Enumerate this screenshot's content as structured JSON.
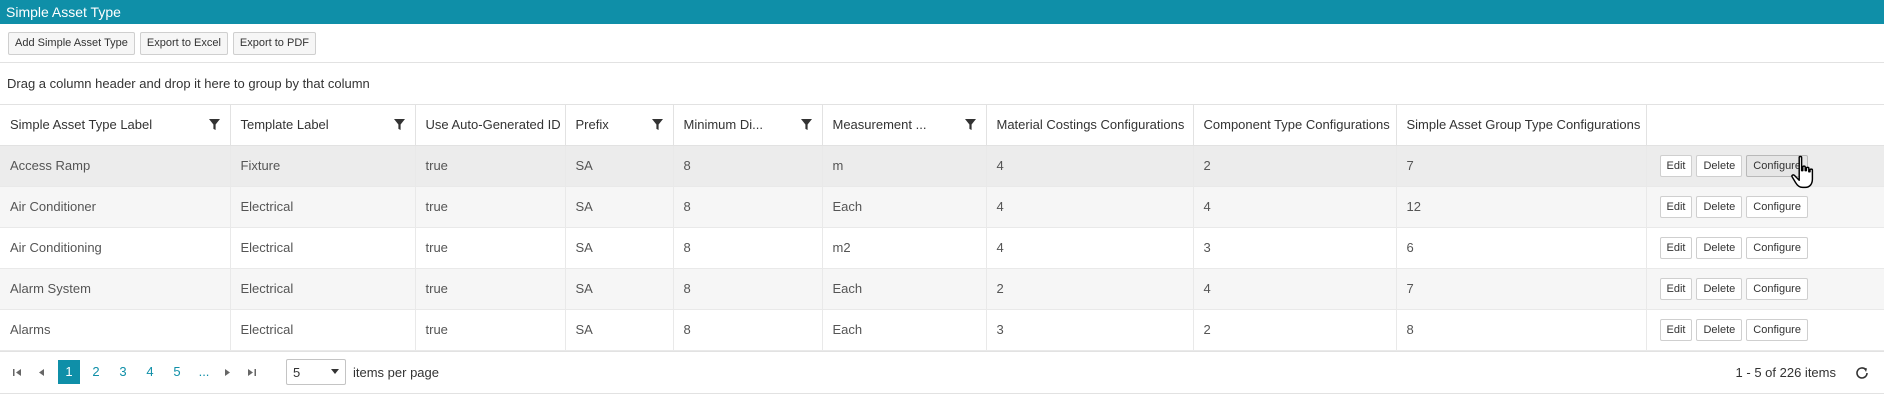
{
  "title": "Simple Asset Type",
  "toolbar": {
    "add_label": "Add Simple Asset Type",
    "excel_label": "Export to Excel",
    "pdf_label": "Export to PDF"
  },
  "group_hint": "Drag a column header and drop it here to group by that column",
  "columns": [
    {
      "label": "Simple Asset Type Label",
      "filter": true
    },
    {
      "label": "Template Label",
      "filter": true
    },
    {
      "label": "Use Auto-Generated ID",
      "filter": false
    },
    {
      "label": "Prefix",
      "filter": true
    },
    {
      "label": "Minimum Di...",
      "filter": true
    },
    {
      "label": "Measurement ...",
      "filter": true
    },
    {
      "label": "Material Costings Configurations",
      "filter": false
    },
    {
      "label": "Component Type Configurations",
      "filter": false
    },
    {
      "label": "Simple Asset Group Type Configurations",
      "filter": false
    },
    {
      "label": "",
      "filter": false
    }
  ],
  "rows": [
    {
      "label": "Access Ramp",
      "template": "Fixture",
      "auto_id": "true",
      "prefix": "SA",
      "min_digits": "8",
      "measurement": "m",
      "material": "4",
      "component": "2",
      "group": "7"
    },
    {
      "label": "Air Conditioner",
      "template": "Electrical",
      "auto_id": "true",
      "prefix": "SA",
      "min_digits": "8",
      "measurement": "Each",
      "material": "4",
      "component": "4",
      "group": "12"
    },
    {
      "label": "Air Conditioning",
      "template": "Electrical",
      "auto_id": "true",
      "prefix": "SA",
      "min_digits": "8",
      "measurement": "m2",
      "material": "4",
      "component": "3",
      "group": "6"
    },
    {
      "label": "Alarm System",
      "template": "Electrical",
      "auto_id": "true",
      "prefix": "SA",
      "min_digits": "8",
      "measurement": "Each",
      "material": "2",
      "component": "4",
      "group": "7"
    },
    {
      "label": "Alarms",
      "template": "Electrical",
      "auto_id": "true",
      "prefix": "SA",
      "min_digits": "8",
      "measurement": "Each",
      "material": "3",
      "component": "2",
      "group": "8"
    }
  ],
  "row_actions": {
    "edit": "Edit",
    "delete": "Delete",
    "configure": "Configure"
  },
  "pager": {
    "pages": [
      "1",
      "2",
      "3",
      "4",
      "5",
      "..."
    ],
    "current_page": "1",
    "page_size": "5",
    "items_per_page_label": "items per page",
    "info": "1 - 5 of 226 items"
  },
  "icons": {
    "filter": "filter-icon",
    "first": "first-page-icon",
    "prev": "prev-page-icon",
    "next": "next-page-icon",
    "last": "last-page-icon",
    "dropdown": "chevron-down-icon",
    "refresh": "refresh-icon",
    "cursor": "hand-pointer-cursor-icon"
  },
  "colors": {
    "accent": "#0f8fa8",
    "header_text": "#ffffff"
  }
}
